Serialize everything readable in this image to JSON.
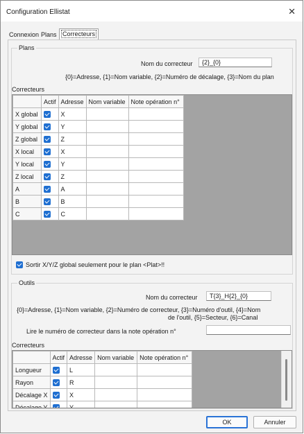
{
  "window": {
    "title": "Configuration Ellistat",
    "close_glyph": "✕"
  },
  "tabs": [
    "Connexion",
    "Plans",
    "Correcteurs"
  ],
  "plans": {
    "group_label": "Plans",
    "name_label": "Nom du correcteur",
    "name_value": "{2}_{0}",
    "legend": "{0}=Adresse, {1}=Nom variable, {2}=Numéro de décalage, {3}=Nom du plan",
    "correcteurs_label": "Correcteurs",
    "columns": [
      "",
      "Actif",
      "Adresse",
      "Nom variable",
      "Note opération n°"
    ],
    "rows": [
      {
        "name": "X global",
        "address": "X"
      },
      {
        "name": "Y global",
        "address": "Y"
      },
      {
        "name": "Z global",
        "address": "Z"
      },
      {
        "name": "X local",
        "address": "X"
      },
      {
        "name": "Y local",
        "address": "Y"
      },
      {
        "name": "Z local",
        "address": "Z"
      },
      {
        "name": "A",
        "address": "A"
      },
      {
        "name": "B",
        "address": "B"
      },
      {
        "name": "C",
        "address": "C"
      }
    ],
    "checkbox_label": "Sortir X/Y/Z global seulement pour le plan <Plat>!!"
  },
  "outils": {
    "group_label": "Outils",
    "name_label": "Nom du correcteur",
    "name_value": "T{3}_H{2}_{0}",
    "legend_line1": "{0}=Adresse, {1}=Nom variable, {2}=Numéro de correcteur, {3}=Numéro d'outil, {4}=Nom",
    "legend_line2": "de l'outil, {5}=Secteur, {6}=Canal",
    "read_label": "Lire le numéro de correcteur dans la note opération n°",
    "read_value": "",
    "correcteurs_label": "Correcteurs",
    "columns": [
      "",
      "Actif",
      "Adresse",
      "Nom variable",
      "Note opération n°"
    ],
    "rows": [
      {
        "name": "Longueur",
        "address": "L"
      },
      {
        "name": "Rayon",
        "address": "R"
      },
      {
        "name": "Décalage X",
        "address": "X"
      },
      {
        "name": "Décalage Y",
        "address": "Y"
      }
    ]
  },
  "buttons": {
    "ok": "OK",
    "cancel": "Annuler"
  }
}
